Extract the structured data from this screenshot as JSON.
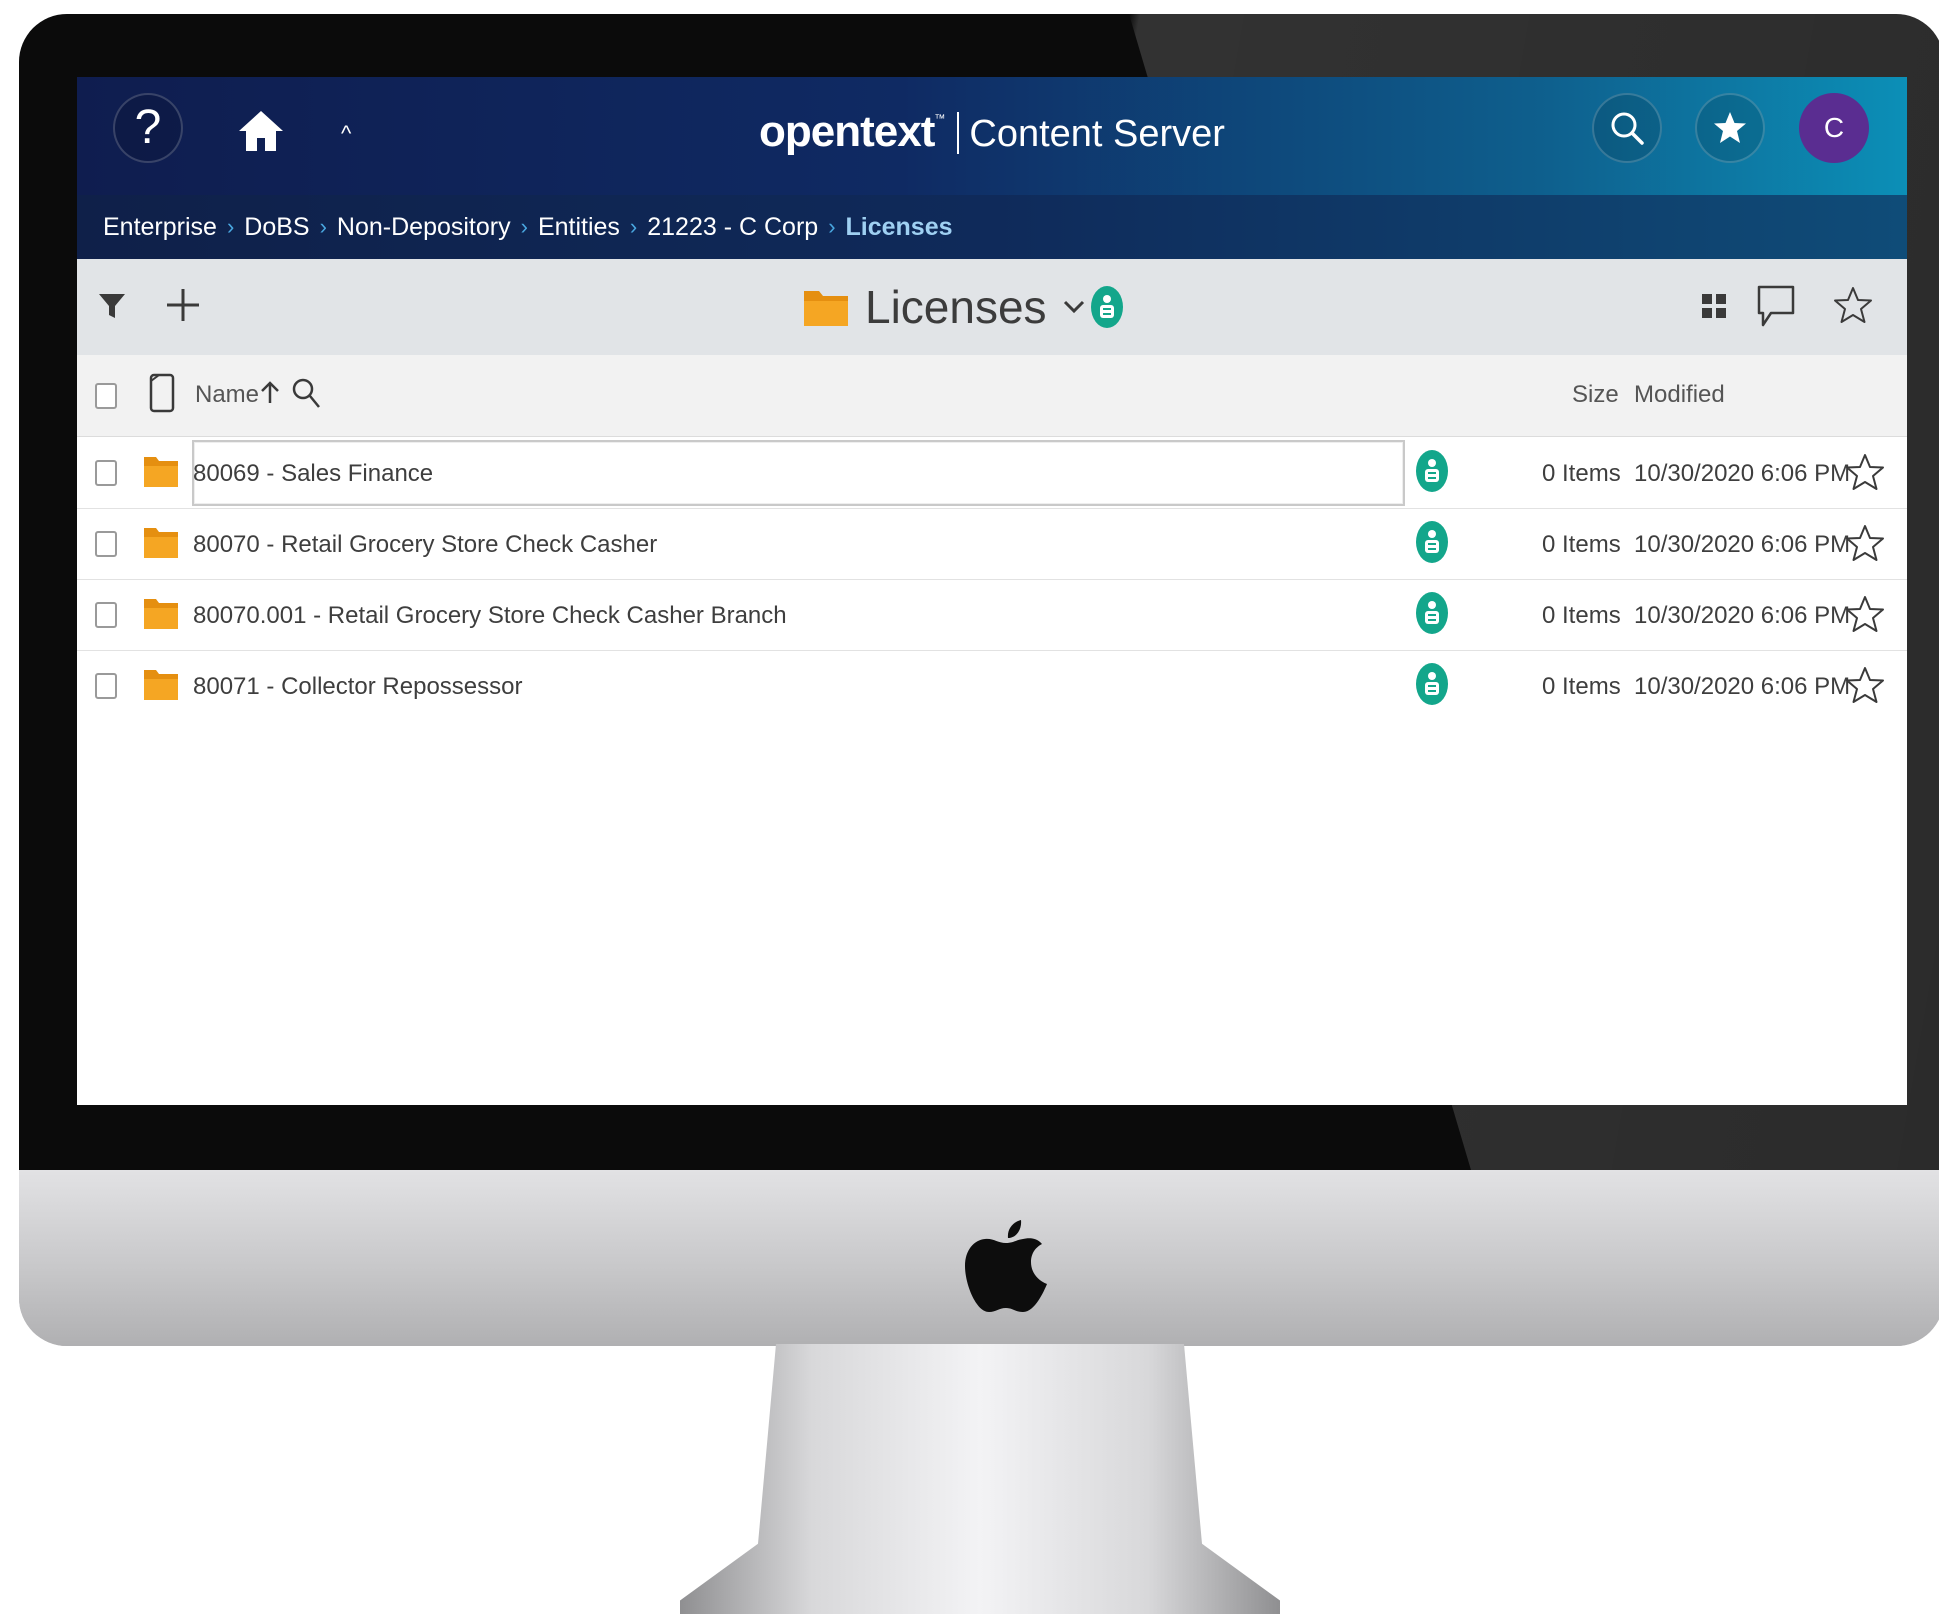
{
  "header": {
    "help_glyph": "?",
    "up_glyph": "^",
    "logo": "opentext",
    "logo_tm": "™",
    "product": "Content Server",
    "avatar_initial": "C",
    "header_gradient": [
      "#0f1d4f",
      "#0c8fb7"
    ],
    "avatar_color": "#5a2d91"
  },
  "breadcrumb": [
    {
      "label": "Enterprise"
    },
    {
      "label": "DoBS"
    },
    {
      "label": "Non-Depository"
    },
    {
      "label": "Entities"
    },
    {
      "label": "21223 - C Corp"
    },
    {
      "label": "Licenses"
    }
  ],
  "toolbar": {
    "title": "Licenses",
    "icons": [
      "filter-icon",
      "add-icon",
      "folder-icon",
      "chevron-down-icon",
      "workspace-badge-icon",
      "grid-view-icon",
      "comment-icon",
      "star-icon"
    ]
  },
  "table": {
    "columns": {
      "name": "Name",
      "size": "Size",
      "modified": "Modified"
    },
    "rows": [
      {
        "name": "80069 - Sales Finance",
        "size": "0 Items",
        "modified": "10/30/2020 6:06 PM"
      },
      {
        "name": "80070 - Retail Grocery Store Check Casher",
        "size": "0 Items",
        "modified": "10/30/2020 6:06 PM"
      },
      {
        "name": "80070.001 - Retail Grocery Store Check Casher Branch",
        "size": "0 Items",
        "modified": "10/30/2020 6:06 PM"
      },
      {
        "name": "80071 - Collector Repossessor",
        "size": "0 Items",
        "modified": "10/30/2020 6:06 PM"
      }
    ]
  },
  "colors": {
    "folder": "#f0a324",
    "badge": "#13a68b",
    "breadcrumb_current": "#9fd0f2"
  }
}
